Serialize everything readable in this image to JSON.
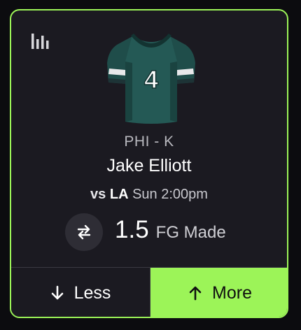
{
  "card": {
    "team_position": "PHI - K",
    "player_name": "Jake Elliott",
    "jersey_number": "4",
    "matchup": {
      "vs": "vs",
      "opponent": "LA",
      "time": "Sun 2:00pm"
    },
    "line": {
      "value": "1.5",
      "stat": "FG Made"
    },
    "buttons": {
      "less": "Less",
      "more": "More"
    },
    "colors": {
      "accent": "#9cf458",
      "jersey": "#1f4d4a",
      "card_bg": "#1b1a21"
    },
    "icons": {
      "stats": "bar-chart-icon",
      "swap": "swap-icon",
      "less": "arrow-down-icon",
      "more": "arrow-up-icon"
    }
  }
}
